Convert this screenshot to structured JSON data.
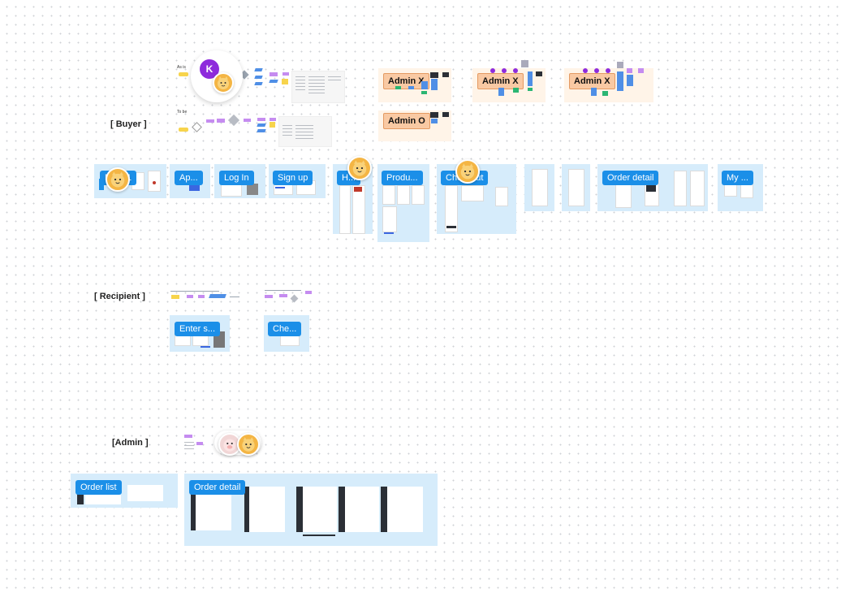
{
  "sections": {
    "buyer": "[ Buyer ]",
    "recipient": "[ Recipient ]",
    "admin": "[Admin ]"
  },
  "flow_labels": {
    "asis": "As is",
    "tobe": "To be"
  },
  "user_badge": {
    "initial": "K"
  },
  "admin_tags": [
    "Admin X",
    "Admin X",
    "Admin X",
    "Admin O"
  ],
  "buyer_frames": [
    "Main 1",
    "Ap...",
    "Log In",
    "Sign up",
    "H...",
    "Produ...",
    "Checkout",
    "Order detail",
    "My ..."
  ],
  "recipient_frames": [
    "Enter s...",
    "Che..."
  ],
  "admin_frames": [
    "Order list",
    "Order detail"
  ],
  "colors": {
    "frame_bg": "#d6ecfb",
    "tag_blue": "#1b8fe8",
    "admin_tag_bg": "#f9c9a3",
    "sticky_yellow": "#f7d44c",
    "sticky_purple": "#c58cf0",
    "sticky_blue": "#4f8fe6",
    "sticky_green": "#2bb673"
  }
}
